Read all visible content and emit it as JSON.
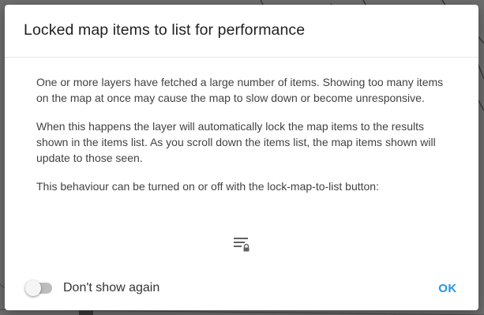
{
  "dialog": {
    "title": "Locked map items to list for performance",
    "paragraphs": [
      "One or more layers have fetched a large number of items. Showing too many items on the map at once may cause the map to slow down or become unresponsive.",
      "When this happens the layer will automatically lock the map items to the results shown in the items list. As you scroll down the items list, the map items shown will update to those seen.",
      "This behaviour can be turned on or off with the lock-map-to-list button:"
    ],
    "icon": "lock-map-to-list-icon",
    "dont_show_again": {
      "label": "Don't show again",
      "checked": false
    },
    "ok_label": "OK"
  },
  "colors": {
    "accent": "#2196f3",
    "title_text": "#212121",
    "body_text": "#424242",
    "toggle_track": "#bdbdbd"
  }
}
